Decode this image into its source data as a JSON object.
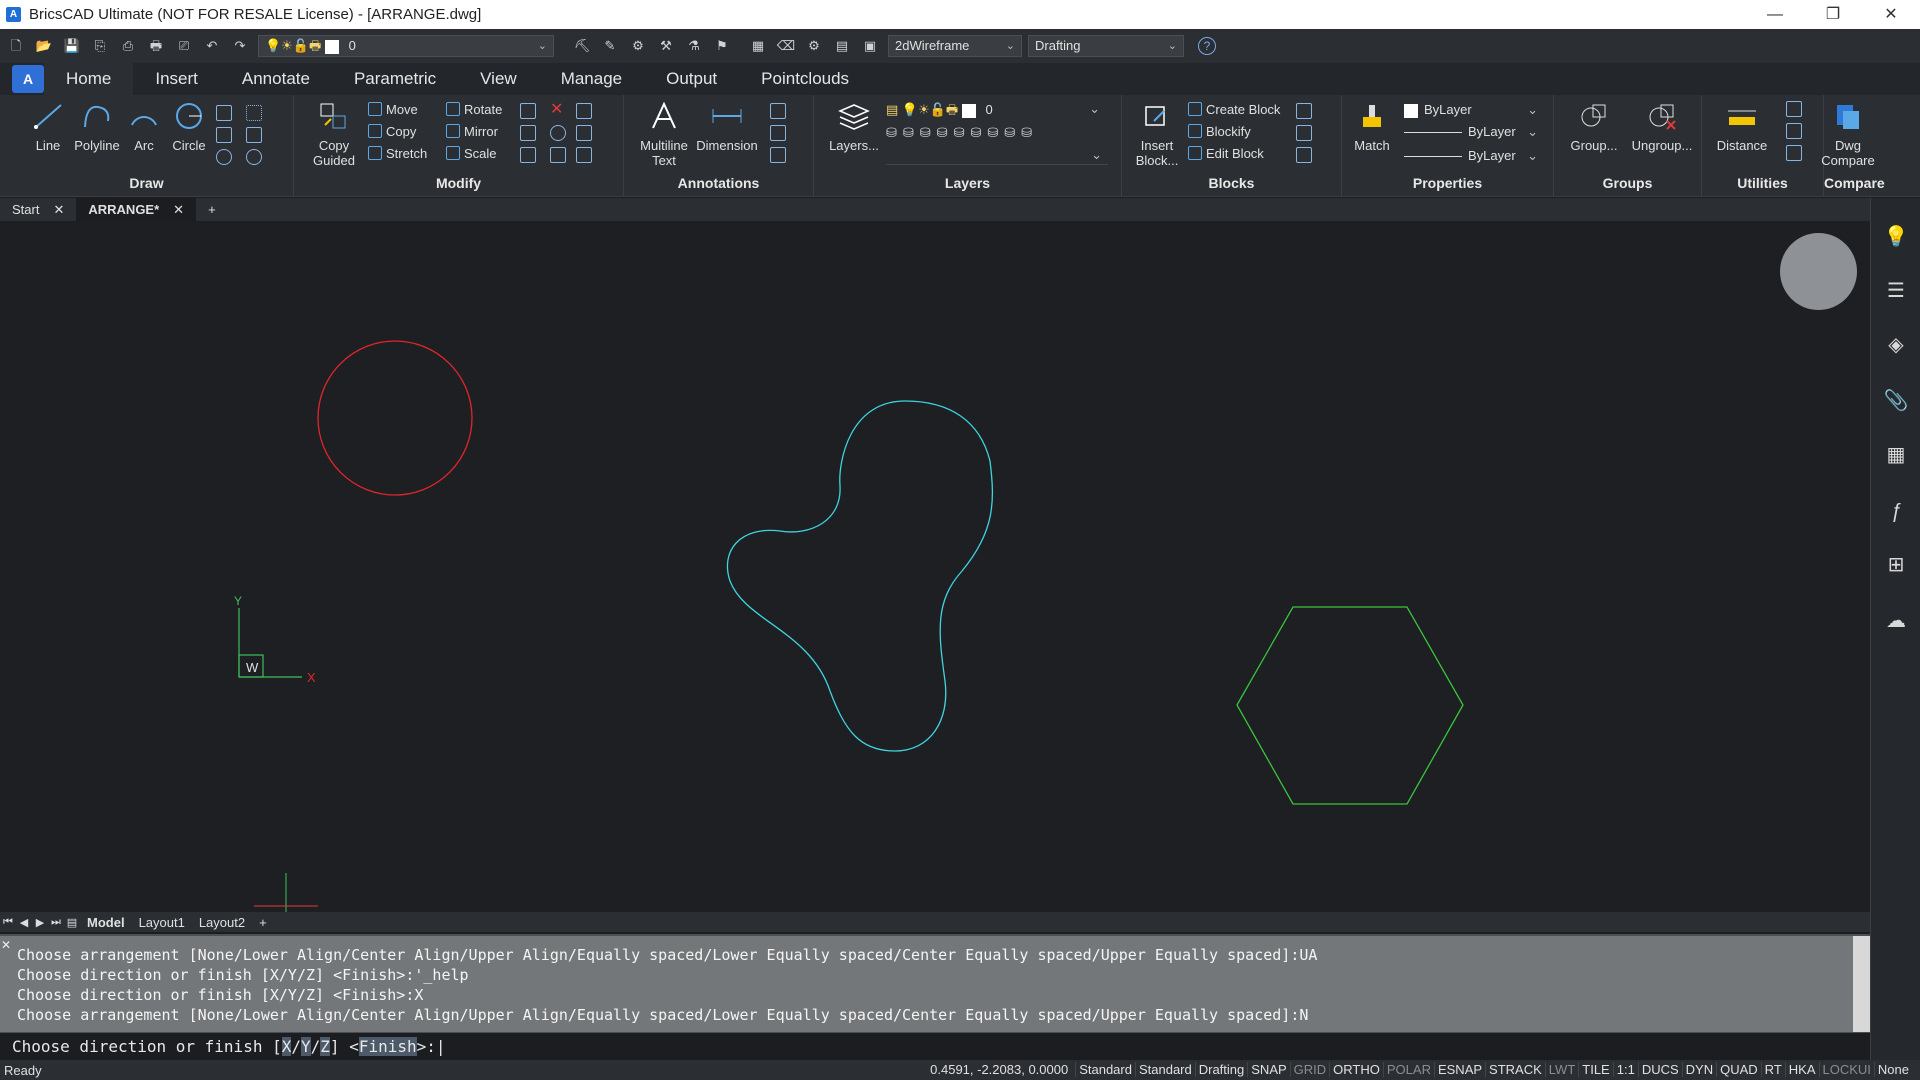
{
  "window": {
    "title": "BricsCAD Ultimate (NOT FOR RESALE License) - [ARRANGE.dwg]",
    "minimize": "—",
    "restore": "❐",
    "close": "✕"
  },
  "qat": {
    "layer_value": "0",
    "visual_style": "2dWireframe",
    "workspace": "Drafting",
    "help_icon": "?"
  },
  "ribbon_tabs": [
    "Home",
    "Insert",
    "Annotate",
    "Parametric",
    "View",
    "Manage",
    "Output",
    "Pointclouds"
  ],
  "ribbon": {
    "draw": {
      "title": "Draw",
      "line": "Line",
      "polyline": "Polyline",
      "arc": "Arc",
      "circle": "Circle"
    },
    "modify": {
      "title": "Modify",
      "copy_guided": "Copy",
      "copy_guided2": "Guided",
      "move": "Move",
      "copy": "Copy",
      "stretch": "Stretch",
      "rotate": "Rotate",
      "mirror": "Mirror",
      "scale": "Scale"
    },
    "annotations": {
      "title": "Annotations",
      "mtext": "Multiline",
      "mtext2": "Text",
      "dimension": "Dimension"
    },
    "layers": {
      "title": "Layers",
      "layers": "Layers...",
      "layer_value": "0"
    },
    "blocks": {
      "title": "Blocks",
      "insert": "Insert",
      "insert2": "Block...",
      "create": "Create Block",
      "blockify": "Blockify",
      "edit": "Edit Block"
    },
    "properties": {
      "title": "Properties",
      "match": "Match",
      "color": "ByLayer",
      "linetype": "ByLayer",
      "lineweight": "ByLayer"
    },
    "groups": {
      "title": "Groups",
      "group": "Group...",
      "ungroup": "Ungroup..."
    },
    "utilities": {
      "title": "Utilities",
      "distance": "Distance"
    },
    "compare": {
      "title": "Compare",
      "dwg": "Dwg",
      "compare": "Compare"
    }
  },
  "doc_tabs": {
    "start": "Start",
    "current": "ARRANGE*",
    "add": "+"
  },
  "drawing": {
    "ucs_y": "Y",
    "ucs_x": "X",
    "ucs_w": "W",
    "colors": {
      "circle": "#e0262a",
      "blob": "#3fd4e0",
      "hexagon": "#39c43a",
      "ucs": "#3fbf5a",
      "ucs_x": "#e0262a"
    }
  },
  "layout_tabs": [
    "Model",
    "Layout1",
    "Layout2"
  ],
  "command_history": [
    "Choose arrangement [None/Lower Align/Center Align/Upper Align/Equally spaced/Lower Equally spaced/Center Equally spaced/Upper Equally spaced]:UA",
    "Choose direction or finish [X/Y/Z] <Finish>:'_help",
    "Choose direction or finish [X/Y/Z] <Finish>:X",
    "Choose arrangement [None/Lower Align/Center Align/Upper Align/Equally spaced/Lower Equally spaced/Center Equally spaced/Upper Equally spaced]:N"
  ],
  "command_prompt": {
    "prefix": "Choose direction or finish [",
    "x": "X",
    "y": "Y",
    "z": "Z",
    "mid": "] <",
    "finish": "Finish",
    "suffix": ">:"
  },
  "status": {
    "ready": "Ready",
    "coords": "0.4591, -2.2083, 0.0000",
    "items": [
      {
        "label": "Standard",
        "on": true
      },
      {
        "label": "Standard",
        "on": true
      },
      {
        "label": "Drafting",
        "on": true
      },
      {
        "label": "SNAP",
        "on": true
      },
      {
        "label": "GRID",
        "on": false
      },
      {
        "label": "ORTHO",
        "on": true
      },
      {
        "label": "POLAR",
        "on": false
      },
      {
        "label": "ESNAP",
        "on": true
      },
      {
        "label": "STRACK",
        "on": true
      },
      {
        "label": "LWT",
        "on": false
      },
      {
        "label": "TILE",
        "on": true
      },
      {
        "label": "1:1",
        "on": true
      },
      {
        "label": "DUCS",
        "on": true
      },
      {
        "label": "DYN",
        "on": true
      },
      {
        "label": "QUAD",
        "on": true
      },
      {
        "label": "RT",
        "on": true
      },
      {
        "label": "HKA",
        "on": true
      },
      {
        "label": "LOCKUI",
        "on": false
      },
      {
        "label": "None",
        "on": true
      }
    ]
  }
}
